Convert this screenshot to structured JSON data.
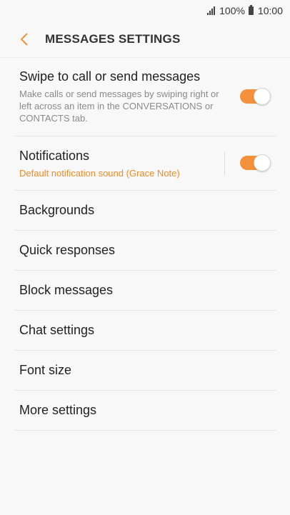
{
  "status_bar": {
    "battery": "100%",
    "time": "10:00"
  },
  "header": {
    "title": "MESSAGES SETTINGS",
    "back_icon": "chevron-left-icon"
  },
  "accent_color": "#f5913a",
  "settings": {
    "swipe": {
      "title": "Swipe to call or send messages",
      "description": "Make calls or send messages by swiping right or left across an item in the CONVERSATIONS or CONTACTS tab.",
      "enabled": true
    },
    "notifications": {
      "title": "Notifications",
      "subtitle": "Default notification sound (Grace Note)",
      "enabled": true
    },
    "items": [
      {
        "label": "Backgrounds"
      },
      {
        "label": "Quick responses"
      },
      {
        "label": "Block messages"
      },
      {
        "label": "Chat settings"
      },
      {
        "label": "Font size"
      },
      {
        "label": "More settings"
      }
    ]
  }
}
